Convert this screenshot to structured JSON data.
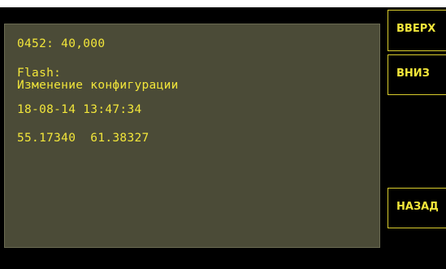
{
  "display": {
    "lines": [
      "0452: 40,000",
      "Flash:",
      "Изменение конфигурации",
      "18-08-14 13:47:34",
      "55.17340  61.38327"
    ]
  },
  "buttons": {
    "up": "ВВЕРХ",
    "down": "ВНИЗ",
    "back": "НАЗАД"
  },
  "colors": {
    "text": "#f2e63a",
    "panel": "#4b4b37",
    "background": "#000000",
    "button_border": "#d9cc2c"
  }
}
